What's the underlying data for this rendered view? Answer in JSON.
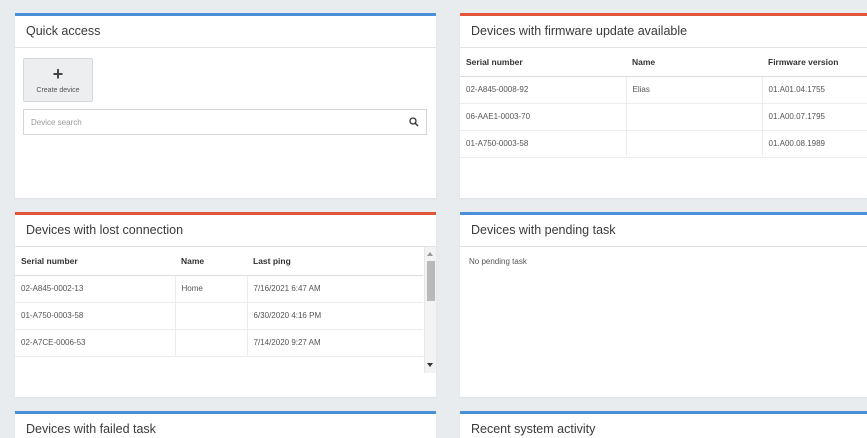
{
  "quick_access": {
    "title": "Quick access",
    "create_label": "Create device",
    "search_placeholder": "Device search"
  },
  "firmware": {
    "title": "Devices with firmware update available",
    "columns": [
      "Serial number",
      "Name",
      "Firmware version"
    ],
    "rows": [
      [
        "02-A845-0008-92",
        "Elias",
        "01.A01.04.1755"
      ],
      [
        "06-AAE1-0003-70",
        "",
        "01.A00.07.1795"
      ],
      [
        "01-A750-0003-58",
        "",
        "01.A00.08.1989"
      ]
    ]
  },
  "lost": {
    "title": "Devices with lost connection",
    "columns": [
      "Serial number",
      "Name",
      "Last ping"
    ],
    "rows": [
      [
        "02-A845-0002-13",
        "Home",
        "7/16/2021 6:47 AM"
      ],
      [
        "01-A750-0003-58",
        "",
        "6/30/2020 4:16 PM"
      ],
      [
        "02-A7CE-0006-53",
        "",
        "7/14/2020 9:27 AM"
      ]
    ]
  },
  "pending": {
    "title": "Devices with pending task",
    "empty_text": "No pending task"
  },
  "failed": {
    "title": "Devices with failed task"
  },
  "recent": {
    "title": "Recent system activity"
  },
  "colors": {
    "accent_blue": "#4a90d9",
    "accent_red": "#e2553b"
  }
}
